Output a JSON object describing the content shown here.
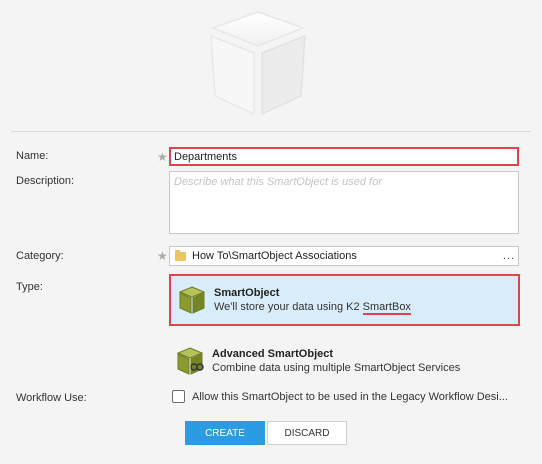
{
  "form": {
    "name_label": "Name:",
    "name_value": "Departments",
    "description_label": "Description:",
    "description_placeholder": "Describe what this SmartObject is used for",
    "category_label": "Category:",
    "category_value": "How To\\SmartObject Associations",
    "category_button": "...",
    "type_label": "Type:",
    "workflow_label": "Workflow Use:",
    "required_marker": "★"
  },
  "types": [
    {
      "title": "SmartObject",
      "description_prefix": "We'll store your data using K2 ",
      "description_highlight": "SmartBox",
      "selected": true,
      "icon": "smartobject-cube-icon"
    },
    {
      "title": "Advanced SmartObject",
      "description": "Combine data using multiple SmartObject Services",
      "selected": false,
      "icon": "advanced-smartobject-cube-icon"
    }
  ],
  "workflow": {
    "checkbox_label": "Allow this SmartObject to be used in the Legacy Workflow Desi...",
    "checked": false
  },
  "buttons": {
    "create": "CREATE",
    "discard": "DISCARD"
  },
  "colors": {
    "accent": "#2b9be2",
    "highlight": "#e0434c",
    "selected_bg": "#d9ecfa",
    "cube_green": "#8a9a2e"
  }
}
